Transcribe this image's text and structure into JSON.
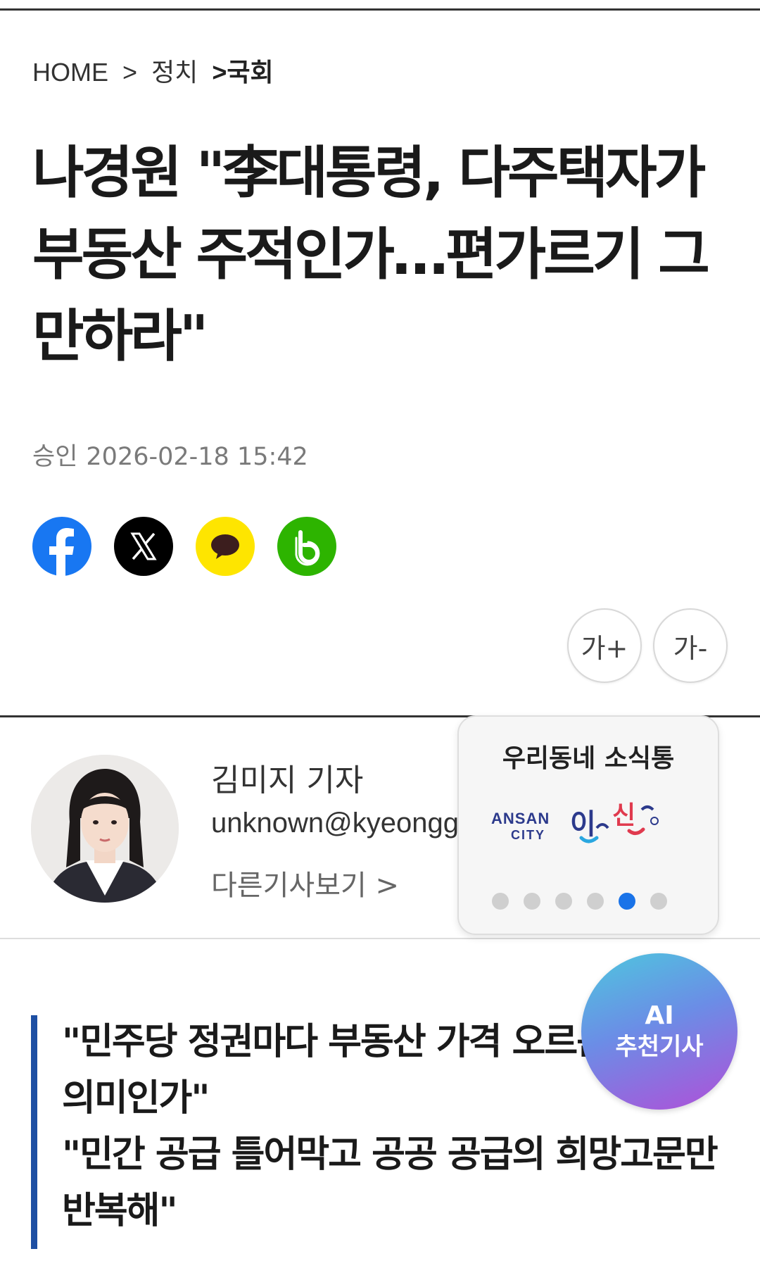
{
  "breadcrumb": {
    "home": "HOME",
    "sep1": ">",
    "section": "정치",
    "current": ">국회"
  },
  "article": {
    "headline": "나경원 \"李대통령, 다주택자가 부동산 주적인가…편가르기 그만하라\"",
    "approved_label": "승인",
    "approved_time": "2026-02-18 15:42"
  },
  "share": {
    "icons": [
      "facebook-icon",
      "x-icon",
      "kakaotalk-icon",
      "band-icon"
    ],
    "colors": {
      "facebook": "#1877F2",
      "x": "#000000",
      "kakao": "#FEE500",
      "band": "#2DB400"
    }
  },
  "font_size": {
    "increase_label": "가+",
    "decrease_label": "가-"
  },
  "author": {
    "name": "김미지 기자",
    "email": "unknown@kyeonggi",
    "more_label": "다른기사보기 >"
  },
  "widget": {
    "title": "우리동네 소식통",
    "logo_text": "ANSAN CITY",
    "logo_korean": "안산",
    "page_count": 6,
    "active_index": 4
  },
  "ai_button": {
    "label_top": "AI",
    "label_bottom": "추천기사"
  },
  "summary": {
    "lines": [
      "\"민주당 정권마다 부동산 가격 오르는 건 무슨 의미인가\"",
      "\"민간 공급 틀어막고 공공 공급의 희망고문만 반복해\""
    ],
    "accent_color": "#1D4FA3"
  }
}
